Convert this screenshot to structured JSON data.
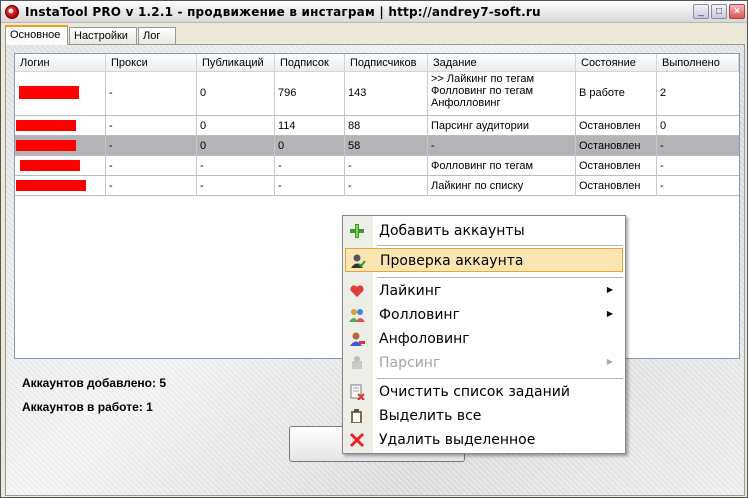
{
  "window": {
    "title": "InstaTool PRO v 1.2.1 - продвижение в инстаграм | http://andrey7-soft.ru"
  },
  "tabs": [
    {
      "label": "Основное",
      "active": true
    },
    {
      "label": "Настройки",
      "active": false
    },
    {
      "label": "Лог",
      "active": false
    }
  ],
  "grid": {
    "columns": [
      "Логин",
      "Прокси",
      "Публикаций",
      "Подписок",
      "Подписчиков",
      "Задание",
      "Состояние",
      "Выполнено"
    ],
    "rows": [
      {
        "login": "",
        "proxy": "-",
        "posts": "0",
        "following": "796",
        "followers": "143",
        "task": [
          ">> Лайкинг по тегам",
          "Фолловинг по тегам",
          "Анфолловинг"
        ],
        "state": "В работе",
        "done": "2",
        "selected": false
      },
      {
        "login": "",
        "proxy": "-",
        "posts": "0",
        "following": "114",
        "followers": "88",
        "task": [
          "Парсинг аудитории"
        ],
        "state": "Остановлен",
        "done": "0",
        "selected": false
      },
      {
        "login": "",
        "proxy": "-",
        "posts": "0",
        "following": "0",
        "followers": "58",
        "task": [
          "-"
        ],
        "state": "Остановлен",
        "done": "-",
        "selected": true
      },
      {
        "login": "",
        "proxy": "-",
        "posts": "-",
        "following": "-",
        "followers": "-",
        "task": [
          "Фолловинг по тегам"
        ],
        "state": "Остановлен",
        "done": "-",
        "selected": false
      },
      {
        "login": "",
        "proxy": "-",
        "posts": "-",
        "following": "-",
        "followers": "-",
        "task": [
          "Лайкинг по списку"
        ],
        "state": "Остановлен",
        "done": "-",
        "selected": false
      }
    ]
  },
  "stats": {
    "added": "Аккаунтов добавлено: 5",
    "working": "Аккаунтов в работе: 1"
  },
  "context_menu": {
    "items": [
      {
        "label": "Добавить аккаунты",
        "icon": "plus-icon",
        "highlighted": false,
        "disabled": false,
        "submenu": false
      },
      {
        "label": "Проверка аккаунта",
        "icon": "user-check-icon",
        "highlighted": true,
        "disabled": false,
        "submenu": false
      },
      {
        "label": "Лайкинг",
        "icon": "heart-icon",
        "highlighted": false,
        "disabled": false,
        "submenu": true
      },
      {
        "label": "Фолловинг",
        "icon": "users-icon",
        "highlighted": false,
        "disabled": false,
        "submenu": true
      },
      {
        "label": "Анфоловинг",
        "icon": "user-remove-icon",
        "highlighted": false,
        "disabled": false,
        "submenu": false
      },
      {
        "label": "Парсинг",
        "icon": "parse-icon",
        "highlighted": false,
        "disabled": true,
        "submenu": true
      },
      {
        "label": "Очистить список заданий",
        "icon": "clear-list-icon",
        "highlighted": false,
        "disabled": false,
        "submenu": false
      },
      {
        "label": "Выделить все",
        "icon": "clipboard-icon",
        "highlighted": false,
        "disabled": false,
        "submenu": false
      },
      {
        "label": "Удалить выделенное",
        "icon": "delete-x-icon",
        "highlighted": false,
        "disabled": false,
        "submenu": false
      }
    ]
  },
  "colors": {
    "accent_tab": "#f0a020",
    "selected_row": "#b4b4b8",
    "highlight": "#fbe6b3",
    "redaction": "#ff0000"
  }
}
